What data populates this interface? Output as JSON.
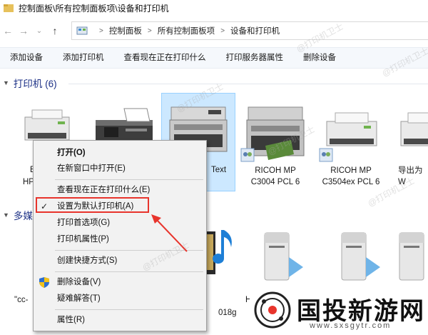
{
  "window": {
    "title": "控制面板\\所有控制面板项\\设备和打印机"
  },
  "nav": {
    "back": "←",
    "forward": "→",
    "dropdown": "⌄",
    "up": "↑"
  },
  "address": {
    "crumbs": [
      "控制面板",
      "所有控制面板项",
      "设备和打印机"
    ],
    "separator": ">"
  },
  "toolbar": {
    "buttons": [
      "添加设备",
      "添加打印机",
      "查看现在正在打印什么",
      "打印服务器属性",
      "删除设备"
    ]
  },
  "printers_section": {
    "title": "打印机 (6)"
  },
  "media_section": {
    "title": "多媒"
  },
  "devices": {
    "p1": "EP",
    "p1b": "HP",
    "p3": "Text",
    "p4a": "RICOH MP",
    "p4b": "C3004 PCL 6",
    "p5a": "RICOH MP",
    "p5b": "C3504ex PCL 6",
    "p6": "导出为W",
    "m1": "\"cc-",
    "m2": "018g",
    "m3": "H"
  },
  "context_menu": {
    "open": "打开(O)",
    "open_new_window": "在新窗口中打开(E)",
    "see_printing": "查看现在正在打印什么(E)",
    "set_default": "设置为默认打印机(A)",
    "print_prefs": "打印首选项(G)",
    "printer_props": "打印机属性(P)",
    "create_shortcut": "创建快捷方式(S)",
    "remove_device": "删除设备(V)",
    "troubleshoot": "疑难解答(T)",
    "properties": "属性(R)"
  },
  "watermark": "@打印机卫士",
  "brand": {
    "name": "国投新游网",
    "url": "www.sxsgytr.com"
  },
  "colors": {
    "selection": "#cce8ff",
    "highlight_box": "#e8342c",
    "section_title": "#1e3287"
  }
}
